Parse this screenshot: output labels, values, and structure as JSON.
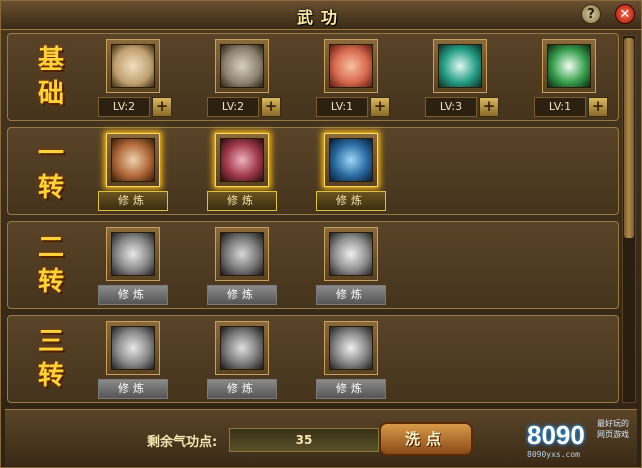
{
  "window": {
    "title": "武功",
    "help_label": "?",
    "close_label": "✕"
  },
  "sections": [
    {
      "label": [
        "基",
        "础"
      ],
      "skills": [
        {
          "level": "LV:2",
          "icon": "scroll-icon",
          "color": "#c0a070"
        },
        {
          "level": "LV:2",
          "icon": "pouch-icon",
          "color": "#8a8070"
        },
        {
          "level": "LV:1",
          "icon": "warrior-portrait-icon",
          "color": "#d86a50"
        },
        {
          "level": "LV:3",
          "icon": "potion-bottle-icon",
          "color": "#28a088"
        },
        {
          "level": "LV:1",
          "icon": "green-aura-icon",
          "color": "#3aa050"
        }
      ]
    },
    {
      "label": [
        "一",
        "转"
      ],
      "skills": [
        {
          "button": "修炼",
          "icon": "crossbow-icon",
          "color": "#b06a3a"
        },
        {
          "button": "修炼",
          "icon": "blade-slash-icon",
          "color": "#a03a4a"
        },
        {
          "button": "修炼",
          "icon": "fist-strike-icon",
          "color": "#2a6aa0"
        }
      ]
    },
    {
      "label": [
        "二",
        "转"
      ],
      "skills": [
        {
          "button": "修炼",
          "icon": "whirlwind-icon",
          "color": "#888888"
        },
        {
          "button": "修炼",
          "icon": "running-figure-icon",
          "color": "#777777"
        },
        {
          "button": "修炼",
          "icon": "spin-slash-icon",
          "color": "#909090"
        }
      ]
    },
    {
      "label": [
        "三",
        "转"
      ],
      "skills": [
        {
          "button": "修炼",
          "icon": "claw-burst-icon",
          "color": "#8a8a8a"
        },
        {
          "button": "修炼",
          "icon": "praying-hands-icon",
          "color": "#7a7a7a"
        },
        {
          "button": "修炼",
          "icon": "crossed-blades-icon",
          "color": "#858585"
        }
      ]
    }
  ],
  "plus_label": "+",
  "footer": {
    "points_label": "剩余气功点:",
    "points_value": "35",
    "wash_button": "洗点"
  },
  "logo": {
    "main": "8090",
    "sub": "最好玩的网页游戏",
    "url": "8090yxs.com"
  }
}
